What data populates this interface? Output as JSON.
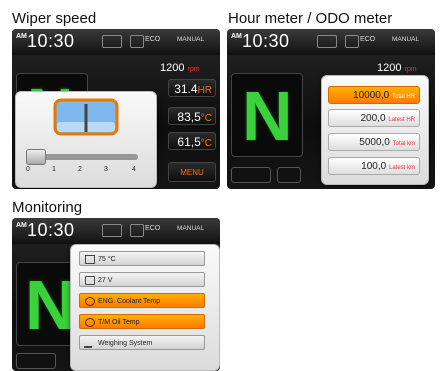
{
  "captions": {
    "wiper": "Wiper speed",
    "hour": "Hour meter / ODO meter",
    "monitor": "Monitoring"
  },
  "status": {
    "ampm": "AM",
    "time": "10:30",
    "eco": "ECO",
    "manual": "MANUAL"
  },
  "gear": "N",
  "wiper": {
    "rpm": "1200",
    "rpm_unit": "rpm",
    "readouts": [
      {
        "value": "31.4",
        "unit": "HR"
      },
      {
        "value": "83,5",
        "unit": "°C"
      },
      {
        "value": "61,5",
        "unit": "°C"
      }
    ],
    "menu": "MENU",
    "scale": [
      "0",
      "1",
      "2",
      "3",
      "4"
    ],
    "speed_level": 0
  },
  "hour": {
    "rpm": "1200",
    "rpm_unit": "rpm",
    "rows": [
      {
        "value": "10000,0",
        "label": "Total HR"
      },
      {
        "value": "200,0",
        "label": "Latest HR"
      },
      {
        "value": "5000,0",
        "label": "Total km"
      },
      {
        "value": "100,0",
        "label": "Latest km"
      }
    ]
  },
  "monitor": {
    "rows": [
      {
        "icon": "gauge-icon",
        "label": "75 °C"
      },
      {
        "icon": "battery-icon",
        "label": "27 V"
      },
      {
        "icon": "coolant-temp-icon",
        "label": "ENG. Coolant Temp"
      },
      {
        "icon": "oil-temp-icon",
        "label": "T/M Oil Temp"
      },
      {
        "icon": "weighing-icon",
        "label": "Weighing System"
      }
    ]
  },
  "colors": {
    "accent": "#ff7a00",
    "gear_green": "#3ad13a"
  }
}
